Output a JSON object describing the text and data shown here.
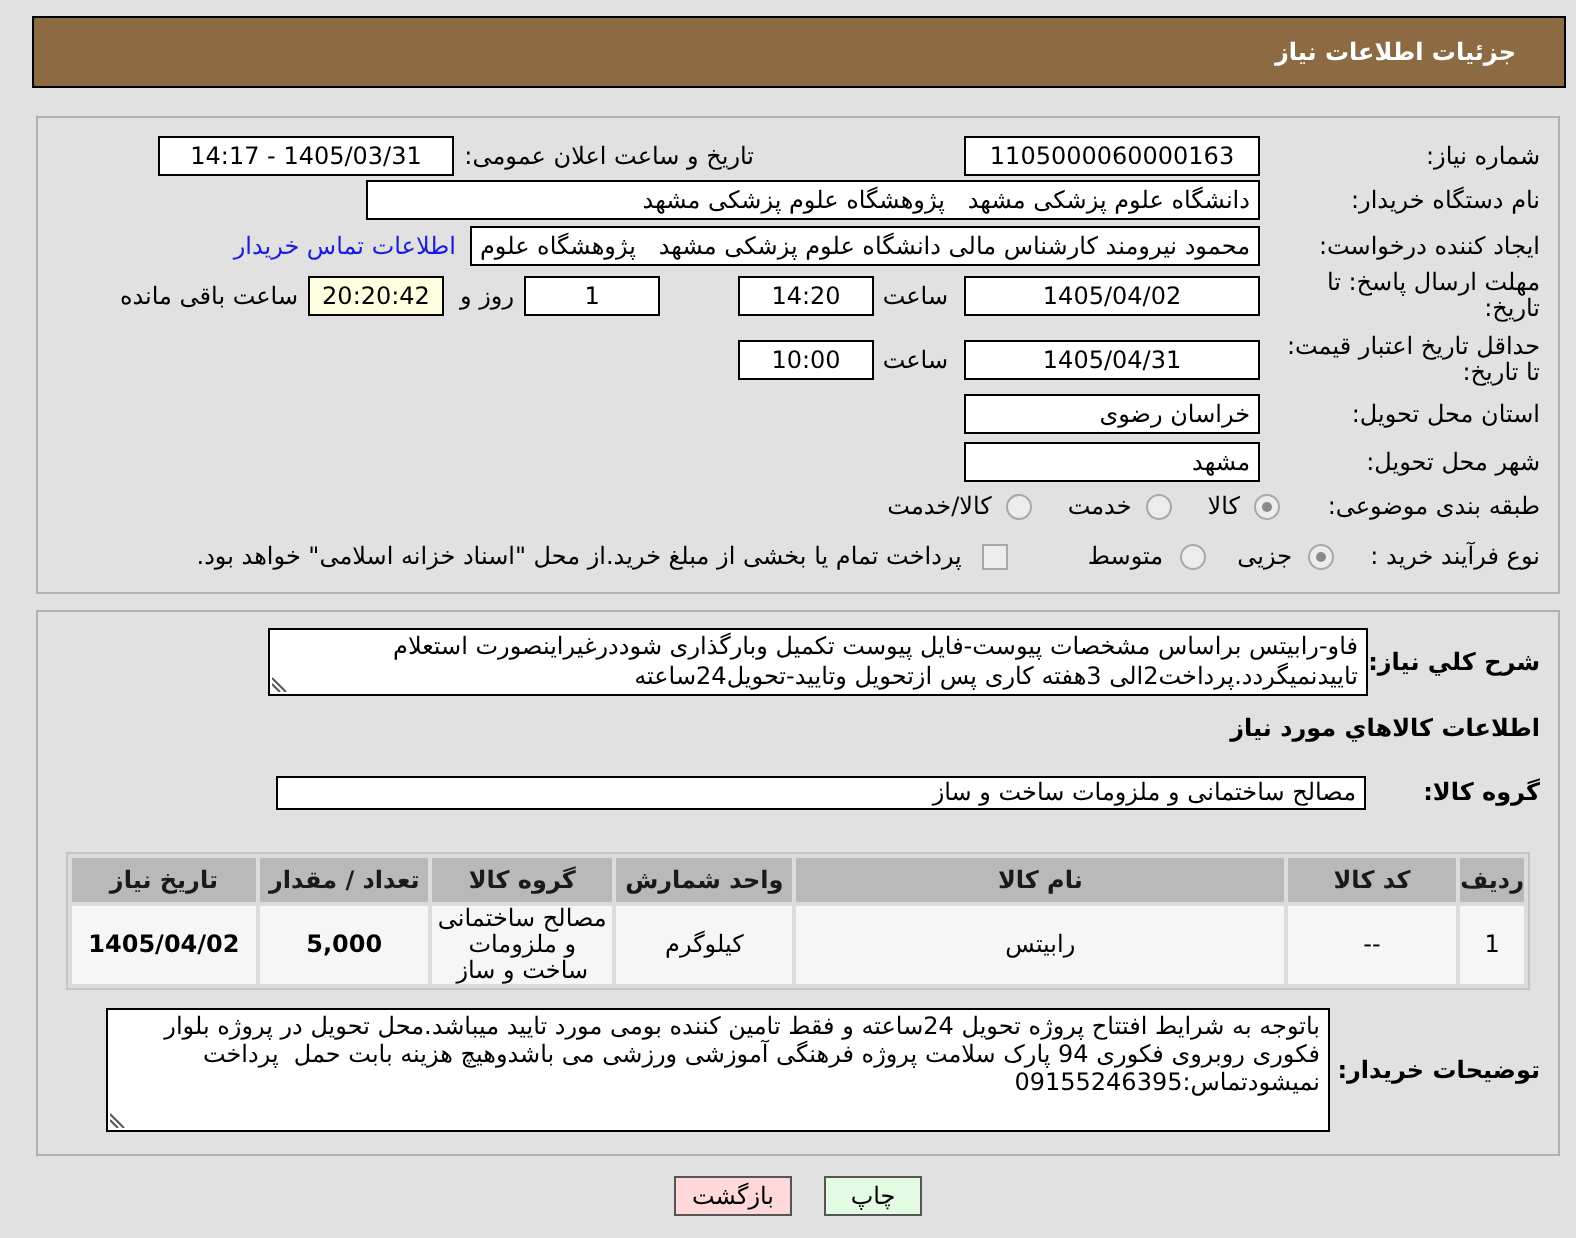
{
  "header": {
    "title": "جزئیات اطلاعات نیاز"
  },
  "details": {
    "need_number": {
      "label": "شماره نیاز:",
      "value": "1105000060000163"
    },
    "announcement": {
      "label": "تاریخ و ساعت اعلان عمومی:",
      "value": "1405/03/31 - 14:17"
    },
    "buyer_org": {
      "label": "نام دستگاه خریدار:",
      "value": "دانشگاه علوم پزشکی مشهد   پژوهشگاه علوم پزشکی مشهد"
    },
    "requester": {
      "label": "ایجاد کننده درخواست:",
      "value": "محمود نیرومند کارشناس مالی دانشگاه علوم پزشکی مشهد   پژوهشگاه علوم",
      "contact_link": "اطلاعات تماس خریدار"
    },
    "reply_deadline": {
      "label": "مهلت ارسال پاسخ: تا تاریخ:",
      "date": "1405/04/02",
      "time_label": "ساعت",
      "time": "14:20",
      "days": "1",
      "days_label": "روز و",
      "remaining": "20:20:42",
      "remaining_label": "ساعت باقی مانده"
    },
    "price_validity": {
      "label": "حداقل تاریخ اعتبار قیمت: تا تاریخ:",
      "date": "1405/04/31",
      "time_label": "ساعت",
      "time": "10:00"
    },
    "delivery_province": {
      "label": "استان محل تحویل:",
      "value": "خراسان رضوی"
    },
    "delivery_city": {
      "label": "شهر محل تحویل:",
      "value": "مشهد"
    },
    "category": {
      "label": "طبقه بندی موضوعی:",
      "options": [
        {
          "label": "کالا",
          "selected": true
        },
        {
          "label": "خدمت",
          "selected": false
        },
        {
          "label": "کالا/خدمت",
          "selected": false
        }
      ]
    },
    "purchase_type": {
      "label": "نوع فرآیند خرید :",
      "options": [
        {
          "label": "جزیی",
          "selected": true
        },
        {
          "label": "متوسط",
          "selected": false
        }
      ],
      "treasury_payment": {
        "label": "پرداخت تمام یا بخشی از مبلغ خرید.از محل \"اسناد خزانه اسلامی\" خواهد بود.",
        "checked": false
      }
    }
  },
  "need": {
    "description": {
      "label": "شرح كلي نياز:",
      "value": "فاو-رابیتس براساس مشخصات پیوست-فایل پیوست تکمیل وبارگذاری شوددرغیراینصورت استعلام تاییدنمیگردد.پرداخت2الی 3هفته کاری پس ازتحویل وتایید-تحویل24ساعته"
    },
    "goods_title": "اطلاعات كالاهاي مورد نياز",
    "goods_group": {
      "label": "گروه کالا:",
      "value": "مصالح ساختمانی و ملزومات ساخت و ساز"
    },
    "table": {
      "columns": [
        "ردیف",
        "کد کالا",
        "نام کالا",
        "واحد شمارش",
        "گروه کالا",
        "تعداد / مقدار",
        "تاریخ نیاز"
      ],
      "rows": [
        [
          "1",
          "--",
          "رابیتس",
          "کیلوگرم",
          "مصالح ساختمانی و ملزومات ساخت و ساز",
          "5,000",
          "1405/04/02"
        ]
      ]
    },
    "buyer_notes": {
      "label": "توضیحات خریدار:",
      "value": "باتوجه به شرایط افتتاح پروژه تحویل 24ساعته و فقط تامین کننده بومی مورد تایید میباشد.محل تحویل در پروژه بلوار فکوری روبروی فکوری 94 پارک سلامت پروژه فرهنگی آموزشی ورزشی می باشدوهیچ هزینه بابت حمل  پرداخت نمیشودتماس:09155246395"
    }
  },
  "buttons": [
    {
      "label": "چاپ",
      "kind": "print"
    },
    {
      "label": "بازگشت",
      "kind": "back"
    }
  ]
}
